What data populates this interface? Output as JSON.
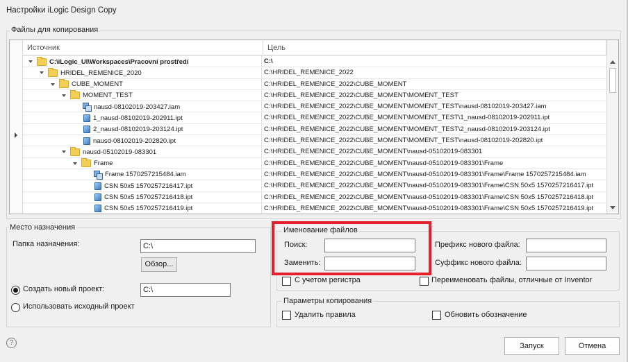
{
  "window": {
    "title": "Настройки iLogic Design Copy"
  },
  "files_group": {
    "label": "Файлы для копирования"
  },
  "grid": {
    "col_source": "Источник",
    "col_target": "Цель",
    "rows": [
      {
        "level": 0,
        "icon": "folder-icon",
        "source": "C:\\iLogic_UI\\Workspaces\\Pracovní prostředí",
        "target": "C:\\",
        "bold": true,
        "expanded": true
      },
      {
        "level": 1,
        "icon": "folder-icon",
        "source": "HRIDEL_REMENICE_2020",
        "target": "C:\\HRIDEL_REMENICE_2022",
        "expanded": true
      },
      {
        "level": 2,
        "icon": "folder-icon",
        "source": "CUBE_MOMENT",
        "target": "C:\\HRIDEL_REMENICE_2022\\CUBE_MOMENT",
        "expanded": true
      },
      {
        "level": 3,
        "icon": "folder-icon",
        "source": "MOMENT_TEST",
        "target": "C:\\HRIDEL_REMENICE_2022\\CUBE_MOMENT\\MOMENT_TEST",
        "expanded": true
      },
      {
        "level": 4,
        "icon": "assembly-icon",
        "source": "nausd-08102019-203427.iam",
        "target": "C:\\HRIDEL_REMENICE_2022\\CUBE_MOMENT\\MOMENT_TEST\\nausd-08102019-203427.iam"
      },
      {
        "level": 4,
        "icon": "part-icon",
        "source": "1_nausd-08102019-202911.ipt",
        "target": "C:\\HRIDEL_REMENICE_2022\\CUBE_MOMENT\\MOMENT_TEST\\1_nausd-08102019-202911.ipt"
      },
      {
        "level": 4,
        "icon": "part-icon",
        "source": "2_nausd-08102019-203124.ipt",
        "target": "C:\\HRIDEL_REMENICE_2022\\CUBE_MOMENT\\MOMENT_TEST\\2_nausd-08102019-203124.ipt"
      },
      {
        "level": 4,
        "icon": "part-icon",
        "source": "nausd-08102019-202820.ipt",
        "target": "C:\\HRIDEL_REMENICE_2022\\CUBE_MOMENT\\MOMENT_TEST\\nausd-08102019-202820.ipt"
      },
      {
        "level": 3,
        "icon": "folder-icon",
        "source": "nausd-05102019-083301",
        "target": "C:\\HRIDEL_REMENICE_2022\\CUBE_MOMENT\\nausd-05102019-083301",
        "expanded": true
      },
      {
        "level": 4,
        "icon": "folder-icon",
        "source": "Frame",
        "target": "C:\\HRIDEL_REMENICE_2022\\CUBE_MOMENT\\nausd-05102019-083301\\Frame",
        "expanded": true
      },
      {
        "level": 5,
        "icon": "assembly-icon",
        "source": "Frame 1570257215484.iam",
        "target": "C:\\HRIDEL_REMENICE_2022\\CUBE_MOMENT\\nausd-05102019-083301\\Frame\\Frame 1570257215484.iam"
      },
      {
        "level": 5,
        "icon": "part-icon",
        "source": "CSN 50x5 1570257216417.ipt",
        "target": "C:\\HRIDEL_REMENICE_2022\\CUBE_MOMENT\\nausd-05102019-083301\\Frame\\CSN 50x5 1570257216417.ipt"
      },
      {
        "level": 5,
        "icon": "part-icon",
        "source": "CSN 50x5 1570257216418.ipt",
        "target": "C:\\HRIDEL_REMENICE_2022\\CUBE_MOMENT\\nausd-05102019-083301\\Frame\\CSN 50x5 1570257216418.ipt"
      },
      {
        "level": 5,
        "icon": "part-icon",
        "source": "CSN 50x5 1570257216419.ipt",
        "target": "C:\\HRIDEL_REMENICE_2022\\CUBE_MOMENT\\nausd-05102019-083301\\Frame\\CSN 50x5 1570257216419.ipt"
      }
    ]
  },
  "destination": {
    "label": "Место назначения",
    "folder_label": "Папка назначения:",
    "folder_value": "C:\\",
    "browse_button": "Обзор...",
    "create_project_label": "Создать новый проект:",
    "create_project_value": "C:\\",
    "use_source_label": "Использовать исходный проект",
    "selected_option": "create_project"
  },
  "naming": {
    "label": "Именование файлов",
    "search_label": "Поиск:",
    "search_value": "",
    "replace_label": "Заменить:",
    "replace_value": "",
    "prefix_label": "Префикс нового файла:",
    "prefix_value": "",
    "suffix_label": "Суффикс нового файла:",
    "suffix_value": "",
    "case_label": "С учетом регистра",
    "case_checked": false,
    "rename_non_inventor_label": "Переименовать файлы, отличные от Inventor",
    "rename_non_inventor_checked": false,
    "highlight_color": "#e3202b"
  },
  "copy_options": {
    "label": "Параметры копирования",
    "delete_rules_label": "Удалить правила",
    "delete_rules_checked": false,
    "update_designation_label": "Обновить обозначение",
    "update_designation_checked": false
  },
  "footer": {
    "help_icon_glyph": "?",
    "run_button": "Запуск",
    "cancel_button": "Отмена"
  }
}
